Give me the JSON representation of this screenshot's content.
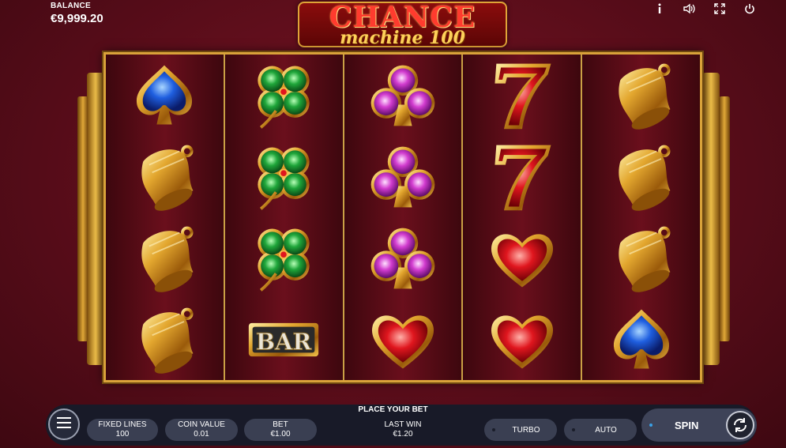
{
  "balance": {
    "label": "BALANCE",
    "value": "€9,999.20"
  },
  "logo": {
    "title": "CHANCE",
    "subtitle": "machine 100"
  },
  "top_icons": [
    "info-icon",
    "sound-icon",
    "fullscreen-icon",
    "power-icon"
  ],
  "reels": [
    [
      "spade",
      "bell",
      "bell",
      "bell"
    ],
    [
      "clover",
      "clover",
      "clover",
      "bar"
    ],
    [
      "club",
      "club",
      "club",
      "heart"
    ],
    [
      "seven",
      "seven",
      "heart",
      "heart"
    ],
    [
      "bell",
      "bell",
      "bell",
      "spade"
    ]
  ],
  "bar_symbol_text": "BAR",
  "bottom": {
    "prompt": "PLACE YOUR BET",
    "fixed_lines": {
      "label": "FIXED LINES",
      "value": "100"
    },
    "coin_value": {
      "label": "COIN VALUE",
      "value": "0.01"
    },
    "bet": {
      "label": "BET",
      "value": "€1.00"
    },
    "last_win": {
      "label": "LAST WIN",
      "value": "€1.20"
    },
    "turbo_label": "TURBO",
    "auto_label": "AUTO",
    "spin_label": "SPIN"
  },
  "colors": {
    "background": "#5a0d1a",
    "gold": "#d9a23a",
    "bar_bg": "#181a28",
    "accent_blue": "#3aa0e6"
  }
}
